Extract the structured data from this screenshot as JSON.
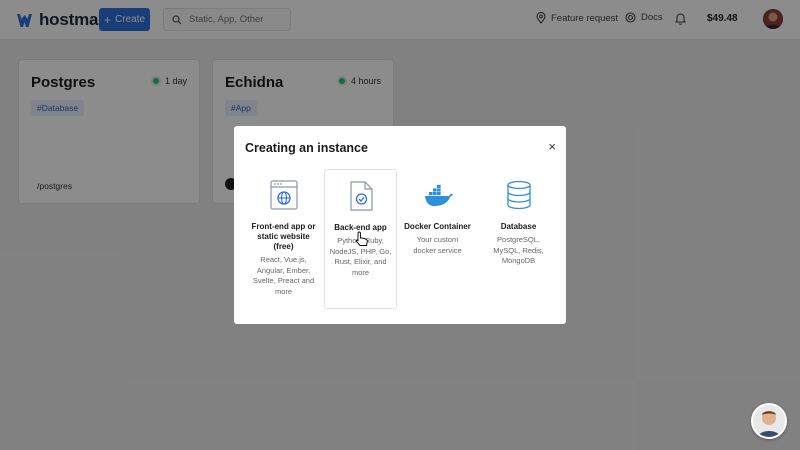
{
  "header": {
    "logo_text": "hostman",
    "create_label": "Create",
    "search_placeholder": "Static, App, Other",
    "feature_request_label": "Feature request",
    "docs_label": "Docs",
    "balance": "$49.48"
  },
  "cards": [
    {
      "title": "Postgres",
      "status": "1 day",
      "tag": "#Database",
      "path": "/postgres"
    },
    {
      "title": "Echidna",
      "status": "4 hours",
      "tag": "#App"
    }
  ],
  "modal": {
    "title": "Creating an instance",
    "close_label": "×",
    "options": [
      {
        "title": "Front-end app or static website (free)",
        "desc": "React, Vue.js, Angular, Ember, Svelte, Preact and more",
        "icon": "browser-globe-icon"
      },
      {
        "title": "Back-end app",
        "desc": "Python, Ruby, NodeJS, PHP, Go, Rust, Elixir, and more",
        "icon": "document-check-icon"
      },
      {
        "title": "Docker Container",
        "desc": "Your custom docker service",
        "icon": "docker-whale-icon"
      },
      {
        "title": "Database",
        "desc": "PostgreSQL, MySQL, Redis, MongoDB",
        "icon": "database-icon"
      }
    ]
  },
  "colors": {
    "accent": "#2f6fdb",
    "status_ok": "#2ec27e",
    "tag_bg": "#eaf0fb"
  }
}
